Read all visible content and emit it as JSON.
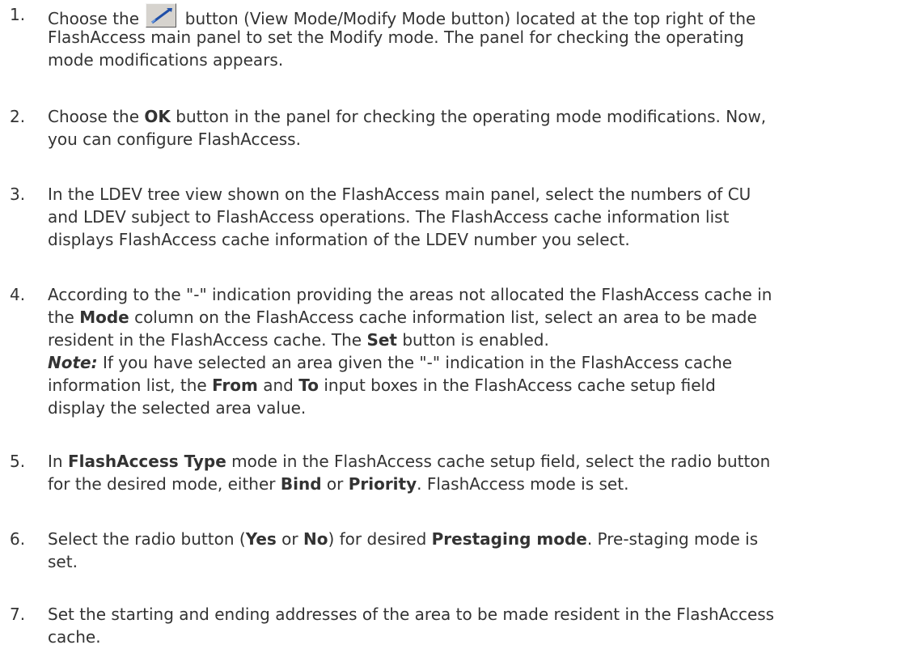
{
  "steps": [
    {
      "number": "1.",
      "line1_pre": "Choose the",
      "button_icon": "view-modify-mode-pen-icon",
      "line1_post": "button (View Mode/Modify Mode button) located at the top right of the",
      "line2": "FlashAccess main panel to set the Modify mode. The panel for checking the operating",
      "line3": "mode modifications appears."
    },
    {
      "number": "2.",
      "line1_pre": "Choose the",
      "line1_bold": "OK",
      "line1_post": "button in the panel for checking the operating mode modifications. Now,",
      "line2": "you can configure FlashAccess."
    },
    {
      "number": "3.",
      "line1": "In the LDEV tree view shown on the FlashAccess main panel, select the numbers of CU",
      "line2": "and LDEV subject to FlashAccess operations. The FlashAccess cache information list",
      "line3": "displays FlashAccess cache information of the LDEV number you select."
    },
    {
      "number": "4.",
      "line1": "According to the \"-\" indication providing the areas not allocated the FlashAccess cache in",
      "line2_pre": "the",
      "line2_bold": "Mode",
      "line2_post": "column on the FlashAccess cache information list, select an area to be made",
      "line3_pre": "resident in the FlashAccess cache. The",
      "line3_bold": "Set",
      "line3_post": "button is enabled.",
      "note_label": "Note:",
      "note_line1": "If you have selected an area given the \"-\" indication in the FlashAccess cache",
      "note_line2_pre": "information list, the",
      "note_line2_bold1": "From",
      "note_line2_mid": "and",
      "note_line2_bold2": "To",
      "note_line2_post": "input boxes in the FlashAccess cache setup field",
      "note_line3": "display the selected area value."
    },
    {
      "number": "5.",
      "line1_pre": "In",
      "line1_bold": "FlashAccess Type",
      "line1_post": "mode in the FlashAccess cache setup field, select the radio button",
      "line2_pre": "for the desired mode, either",
      "line2_bold1": "Bind",
      "line2_mid": "or",
      "line2_bold2": "Priority",
      "line2_post": ". FlashAccess mode is set."
    },
    {
      "number": "6.",
      "line1_pre": "Select the radio button (",
      "line1_bold1": "Yes",
      "line1_mid": "or",
      "line1_bold2": "No",
      "line1_mid2": ") for desired",
      "line1_bold3": "Prestaging mode",
      "line1_post": ". Pre-staging mode is",
      "line2": "set."
    },
    {
      "number": "7.",
      "line1": "Set the starting and ending addresses of the area to be made resident in the FlashAccess",
      "line2": "cache."
    }
  ]
}
